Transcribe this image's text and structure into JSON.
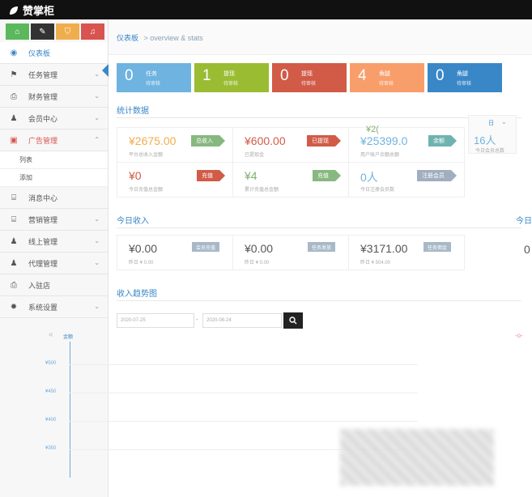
{
  "app": {
    "title": "赞掌柜"
  },
  "quick_buttons": [
    {
      "icon": "home-icon",
      "glyph": "⌂"
    },
    {
      "icon": "pencil-icon",
      "glyph": "✎"
    },
    {
      "icon": "cart-icon",
      "glyph": "⛉"
    },
    {
      "icon": "bell-icon",
      "glyph": "♫"
    }
  ],
  "sidebar": {
    "items": [
      {
        "label": "仪表板",
        "icon": "dashboard-icon",
        "glyph": "◉",
        "active": true
      },
      {
        "label": "任务管理",
        "icon": "flag-icon",
        "glyph": "⚑"
      },
      {
        "label": "财务管理",
        "icon": "printer-icon",
        "glyph": "⎙"
      },
      {
        "label": "会员中心",
        "icon": "user-icon",
        "glyph": "♟"
      },
      {
        "label": "广告管理",
        "icon": "image-icon",
        "glyph": "▣",
        "open": true
      },
      {
        "label": "消息中心",
        "icon": "bookmark-icon",
        "glyph": "⌸"
      },
      {
        "label": "营销管理",
        "icon": "bookmark2-icon",
        "glyph": "⌸"
      },
      {
        "label": "线上管理",
        "icon": "user2-icon",
        "glyph": "♟"
      },
      {
        "label": "代理管理",
        "icon": "user3-icon",
        "glyph": "♟"
      },
      {
        "label": "入驻店",
        "icon": "printer2-icon",
        "glyph": "⎙"
      },
      {
        "label": "系统设置",
        "icon": "gear-icon",
        "glyph": "✹"
      }
    ],
    "sub_items": [
      "列表",
      "添加"
    ]
  },
  "breadcrumb": {
    "home": "仪表板",
    "sub": "> overview & stats"
  },
  "tiles": [
    {
      "num": "0",
      "l1": "任务",
      "l2": "待审核"
    },
    {
      "num": "1",
      "l1": "提现",
      "l2": "待审核"
    },
    {
      "num": "0",
      "l1": "提现",
      "l2": "待审核"
    },
    {
      "num": "4",
      "l1": "角腿",
      "l2": "待审核"
    },
    {
      "num": "0",
      "l1": "角腿",
      "l2": "待审核"
    }
  ],
  "sections": {
    "stats": "统计数据",
    "today": "今日收入",
    "today_right": "今日",
    "trend": "收入趋势图"
  },
  "stats_row1": [
    {
      "val": "¥2675.00",
      "desc": "平台总收入金额",
      "badge": "总收入",
      "badge_color": "green",
      "val_color": "orange"
    },
    {
      "val": "¥600.00",
      "desc": "已提现金",
      "badge": "已提现",
      "badge_color": "red",
      "val_color": "red"
    },
    {
      "val": "¥25399.0",
      "desc": "用户账户余额总额",
      "badge": "余额",
      "badge_color": "teal",
      "val_color": "blue"
    }
  ],
  "stats_row2": [
    {
      "val": "¥0",
      "desc": "今日充值总金额",
      "badge": "充值",
      "badge_color": "red",
      "val_color": "red"
    },
    {
      "val": "¥4",
      "desc": "累计充值总金额",
      "badge": "充值",
      "badge_color": "green",
      "val_color": "green"
    },
    {
      "val": "0人",
      "desc": "今日注册会员数",
      "badge": "注册会员",
      "badge_color": "grey",
      "val_color": "blue"
    }
  ],
  "floating_value": "¥2(",
  "right_card_value": "16人",
  "right_card_desc": "今日会员总数",
  "right_card_dd": "日",
  "today_row": [
    {
      "val": "¥0.00",
      "desc": "昨日 ¥ 0.00",
      "badge": "会员充值"
    },
    {
      "val": "¥0.00",
      "desc": "昨日 ¥ 0.00",
      "badge": "任务发放"
    },
    {
      "val": "¥3171.00",
      "desc": "昨日 ¥ 504.00",
      "badge": "任务佣金"
    }
  ],
  "today_right_val": "0",
  "filters": {
    "start": "2020-07-25",
    "end": "2020-08-24",
    "sep": "-",
    "search_icon": "search-icon"
  },
  "chart_data": {
    "type": "line",
    "ylabel": "金额",
    "y_ticks": [
      "¥500",
      "¥450",
      "¥400",
      "¥350"
    ],
    "ylim": [
      350,
      500
    ],
    "series": []
  }
}
